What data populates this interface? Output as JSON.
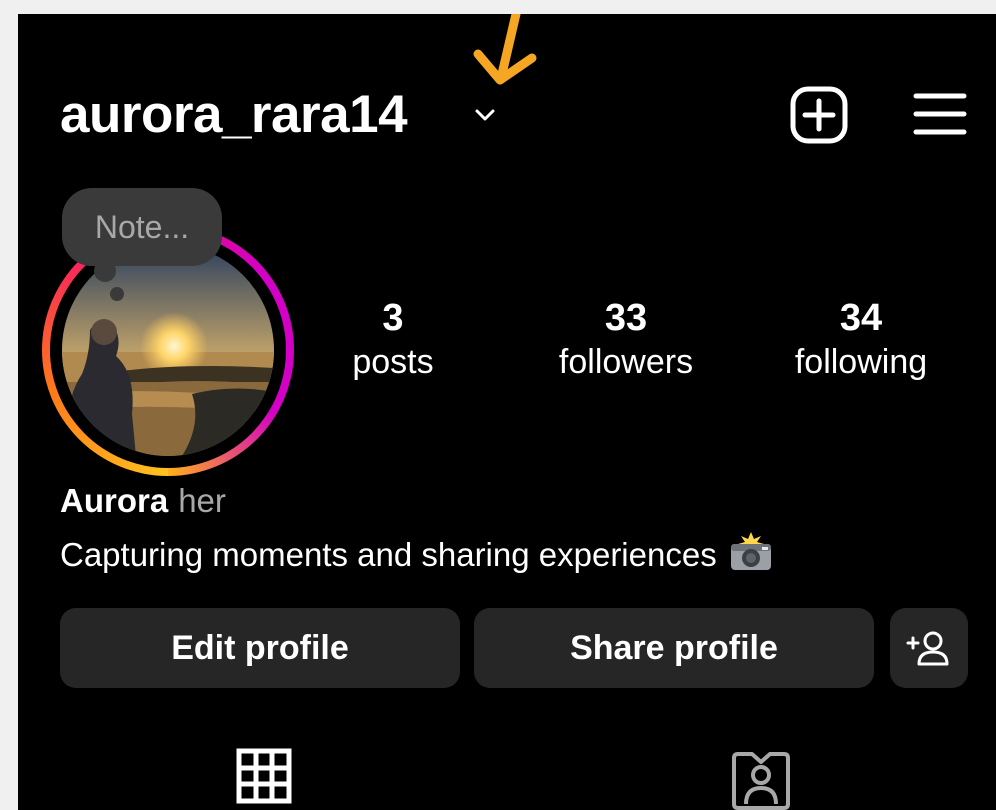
{
  "header": {
    "username": "aurora_rara14",
    "icons": [
      "chevron-down-icon",
      "add-square-icon",
      "hamburger-menu-icon"
    ]
  },
  "note": {
    "placeholder": "Note..."
  },
  "stats": [
    {
      "value": "3",
      "label": "posts"
    },
    {
      "value": "33",
      "label": "followers"
    },
    {
      "value": "34",
      "label": "following"
    }
  ],
  "profile": {
    "name": "Aurora",
    "pronouns": "her",
    "bio": "Capturing moments and sharing experiences"
  },
  "buttons": {
    "edit": "Edit profile",
    "share": "Share profile"
  },
  "tabs": [
    "grid-icon",
    "tagged-icon"
  ],
  "colors": {
    "background": "#000000",
    "button": "#262626",
    "accent_blue": "#0095f6",
    "annotation_arrow": "#f5a623"
  }
}
